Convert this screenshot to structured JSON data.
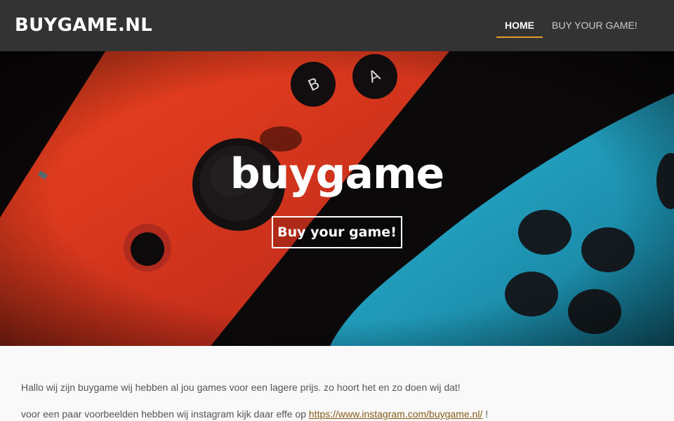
{
  "header": {
    "logo": "BUYGAME.NL",
    "nav": {
      "home": "HOME",
      "buy": "BUY YOUR GAME!"
    },
    "accent_color": "#e79a2c"
  },
  "hero": {
    "title": "buygame",
    "button": "Buy your game!",
    "button_letters": {
      "b": "B",
      "a": "A"
    }
  },
  "content": {
    "paragraph1": "Hallo wij zijn buygame wij hebben al jou games voor een lagere prijs. zo hoort het en zo doen wij dat!",
    "paragraph2_prefix": "voor een paar voorbeelden hebben wij instagram kijk daar effe op ",
    "paragraph2_link": "https://www.instagram.com/buygame.nl/",
    "paragraph2_suffix": " !"
  },
  "colors": {
    "header_bg": "#333333",
    "red_controller": "#e0371f",
    "blue_controller": "#20a7c9"
  }
}
